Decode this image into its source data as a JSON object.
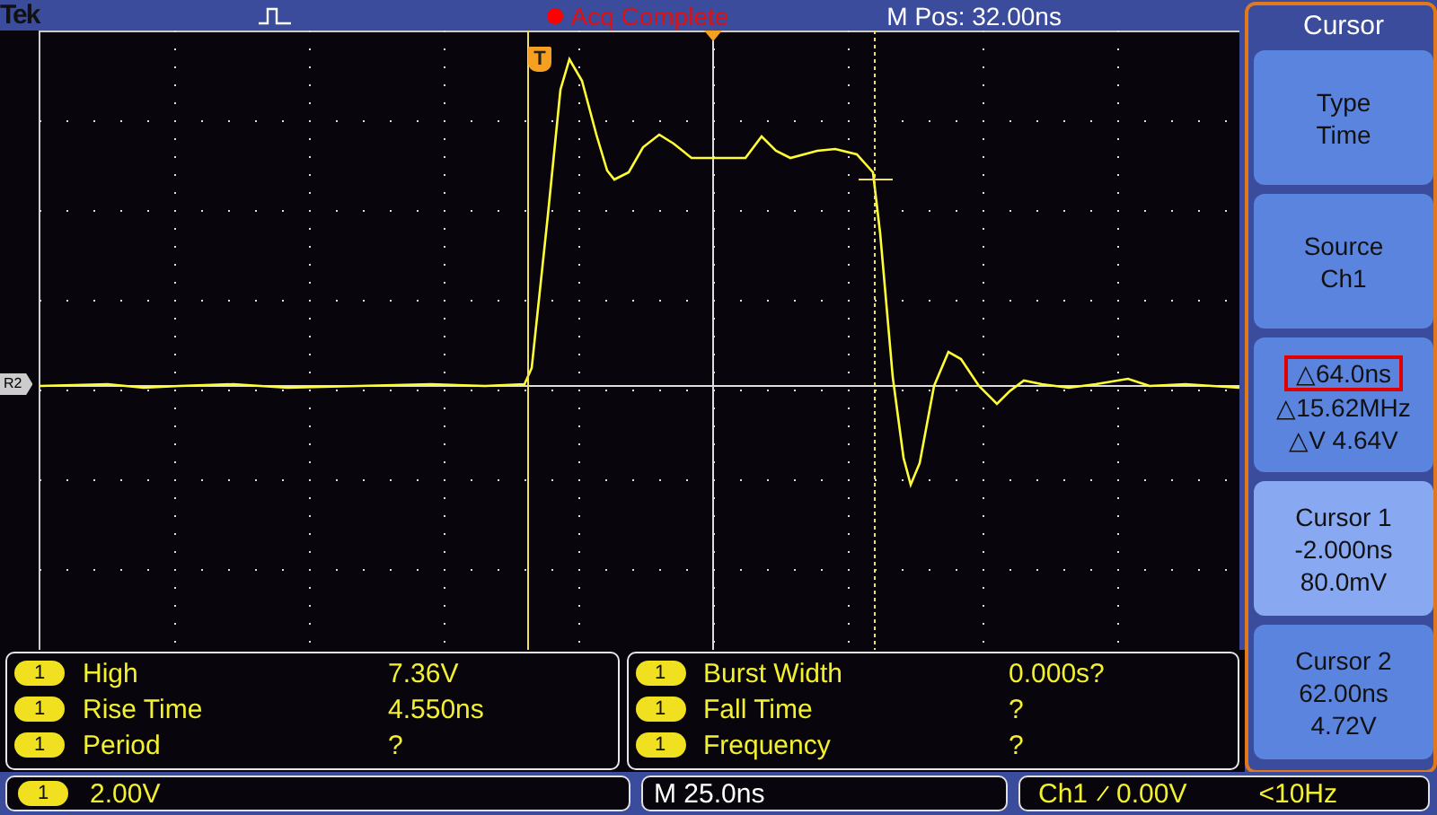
{
  "header": {
    "brand": "Tek",
    "acquisition": "Acq Complete",
    "position": "M Pos: 32.00ns"
  },
  "scope": {
    "trigger_marker": "T",
    "reference_marker": "R2"
  },
  "side_menu": {
    "title": "Cursor",
    "buttons": [
      {
        "lines": [
          {
            "text": "Type",
            "boxed": false
          },
          {
            "text": "Time",
            "boxed": false
          }
        ],
        "selected": false
      },
      {
        "lines": [
          {
            "text": "Source",
            "boxed": false
          },
          {
            "text": "Ch1",
            "boxed": false
          }
        ],
        "selected": false
      },
      {
        "lines": [
          {
            "text": "△64.0ns",
            "boxed": true
          },
          {
            "text": "△15.62MHz",
            "boxed": false
          },
          {
            "text": "△V 4.64V",
            "boxed": false
          }
        ],
        "selected": false
      },
      {
        "lines": [
          {
            "text": "Cursor 1",
            "boxed": false
          },
          {
            "text": "-2.000ns",
            "boxed": false
          },
          {
            "text": "80.0mV",
            "boxed": false
          }
        ],
        "selected": true
      },
      {
        "lines": [
          {
            "text": "Cursor 2",
            "boxed": false
          },
          {
            "text": "62.00ns",
            "boxed": false
          },
          {
            "text": "4.72V",
            "boxed": false
          }
        ],
        "selected": false
      }
    ]
  },
  "measurements": [
    [
      {
        "channel": "1",
        "label": "High",
        "value": "7.36V"
      },
      {
        "channel": "1",
        "label": "Rise Time",
        "value": "4.550ns"
      },
      {
        "channel": "1",
        "label": "Period",
        "value": "?"
      }
    ],
    [
      {
        "channel": "1",
        "label": "Burst Width",
        "value": "0.000s?"
      },
      {
        "channel": "1",
        "label": "Fall Time",
        "value": "?"
      },
      {
        "channel": "1",
        "label": "Frequency",
        "value": "?"
      }
    ]
  ],
  "status_bar": {
    "channel": "1",
    "vertical_scale": "2.00V",
    "timebase": "M 25.0ns",
    "trigger_source": "Ch1",
    "trigger_level": "0.00V",
    "trigger_frequency": "<10Hz"
  }
}
